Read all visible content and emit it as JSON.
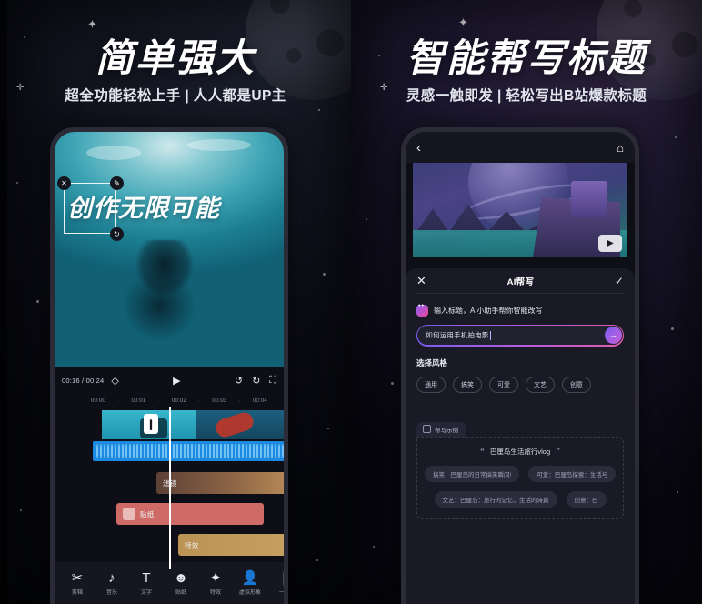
{
  "left_panel": {
    "headline": "简单强大",
    "subline": "超全功能轻松上手 | 人人都是UP主",
    "video": {
      "text_overlay": "创作无限可能",
      "handle_close": "✕",
      "handle_edit": "✎",
      "handle_rotate": "↻"
    },
    "controls": {
      "timecode": "00:16 / 00:24",
      "keyframe_icon": "◇",
      "play_icon": "▶",
      "undo_icon": "↺",
      "redo_icon": "↻",
      "fullscreen_icon": "⛶"
    },
    "ruler": [
      "00:00",
      "00:01",
      "00:02",
      "00:03",
      "00:04"
    ],
    "tracks": {
      "clip_divider_label": "❙",
      "filter_label": "滤镜",
      "sticker_label": "贴纸",
      "effect_label": "特效"
    },
    "toolbar": [
      {
        "icon": "✂",
        "label": "剪辑"
      },
      {
        "icon": "♪",
        "label": "音乐"
      },
      {
        "icon": "T",
        "label": "文字"
      },
      {
        "icon": "☻",
        "label": "贴纸"
      },
      {
        "icon": "✦",
        "label": "特效"
      },
      {
        "icon": "👤",
        "label": "虚拟形象"
      },
      {
        "icon": "❙",
        "label": "一键"
      }
    ]
  },
  "right_panel": {
    "headline": "智能帮写标题",
    "subline": "灵感一触即发 | 轻松写出B站爆款标题",
    "topbar": {
      "back_icon": "‹",
      "home_icon": "⌂"
    },
    "video": {
      "play_icon": "▶"
    },
    "sheet": {
      "close_icon": "✕",
      "title": "AI帮写",
      "confirm_icon": "✓",
      "hint": "输入标题，AI小助手帮你智能改写",
      "input_value": "如何运用手机拍电影",
      "send_icon": "→",
      "style_section_title": "选择风格",
      "styles": [
        "通用",
        "搞笑",
        "可爱",
        "文艺",
        "创意"
      ],
      "examples_tab": "帮写示例",
      "example_quote": "巴厘岛生活旅行vlog",
      "quote_open": "❝",
      "quote_close": "❞",
      "example_rows": [
        [
          "搞笑：巴厘岛的日常搞笑瞬间!",
          "可爱：巴厘岛探索：生活与"
        ],
        [
          "文艺：巴厘岛：旅行的记忆，生活的诗篇",
          "创意：巴"
        ]
      ]
    }
  }
}
